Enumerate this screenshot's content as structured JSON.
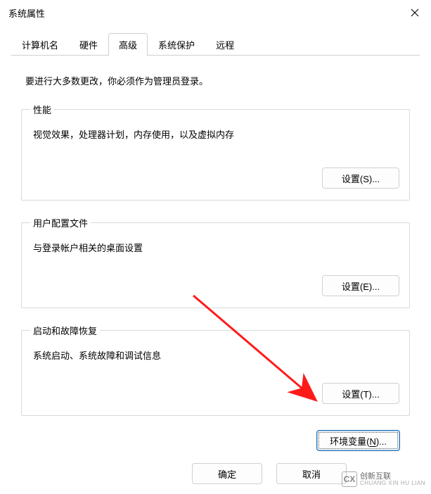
{
  "window": {
    "title": "系统属性"
  },
  "tabs": {
    "computer_name": "计算机名",
    "hardware": "硬件",
    "advanced": "高级",
    "system_protection": "系统保护",
    "remote": "远程",
    "active": "advanced"
  },
  "advanced_panel": {
    "note": "要进行大多数更改，你必须作为管理员登录。",
    "performance": {
      "legend": "性能",
      "desc": "视觉效果，处理器计划，内存使用，以及虚拟内存",
      "button": "设置(S)..."
    },
    "profiles": {
      "legend": "用户配置文件",
      "desc": "与登录帐户相关的桌面设置",
      "button": "设置(E)..."
    },
    "startup": {
      "legend": "启动和故障恢复",
      "desc": "系统启动、系统故障和调试信息",
      "button": "设置(T)..."
    },
    "env_button_prefix": "环境变量(",
    "env_button_hotkey": "N",
    "env_button_suffix": ")..."
  },
  "dialog_buttons": {
    "ok": "确定",
    "cancel": "取消"
  },
  "watermark": {
    "brand_cn": "创新互联",
    "brand_py": "CHUANG XIN HU LIAN"
  }
}
